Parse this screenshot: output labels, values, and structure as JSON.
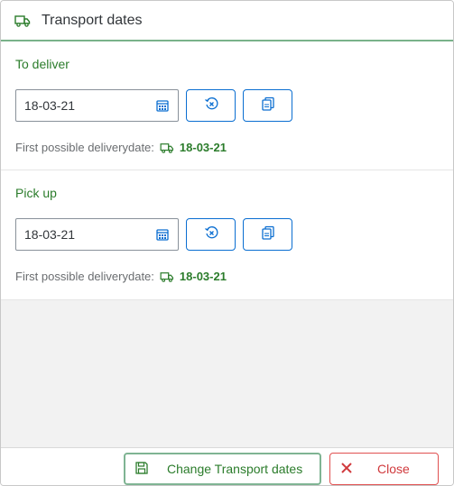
{
  "dialog": {
    "title": "Transport dates",
    "header_icon": "truck-icon"
  },
  "sections": [
    {
      "label": "To deliver",
      "date_value": "18-03-21",
      "info_label": "First possible deliverydate:",
      "info_date": "18-03-21"
    },
    {
      "label": "Pick up",
      "date_value": "18-03-21",
      "info_label": "First possible deliverydate:",
      "info_date": "18-03-21"
    }
  ],
  "footer": {
    "change_label": "Change Transport dates",
    "close_label": "Close"
  },
  "colors": {
    "accent_green": "#2b7c2b",
    "button_blue": "#0a6ed1",
    "close_red": "#d0393c"
  }
}
